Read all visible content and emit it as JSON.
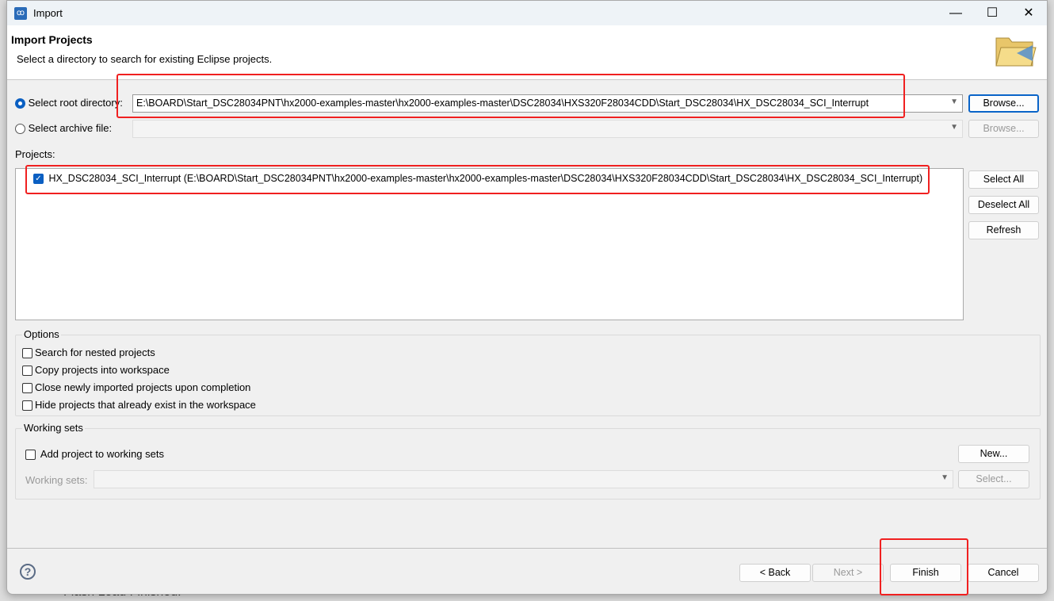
{
  "background_text": "Flash Load Finished.",
  "window": {
    "title": "Import"
  },
  "header": {
    "title": "Import Projects",
    "subtitle": "Select a directory to search for existing Eclipse projects."
  },
  "source": {
    "root_label": "Select root directory:",
    "root_value": "E:\\BOARD\\Start_DSC28034PNT\\hx2000-examples-master\\hx2000-examples-master\\DSC28034\\HXS320F28034CDD\\Start_DSC28034\\HX_DSC28034_SCI_Interrupt",
    "archive_label": "Select archive file:",
    "archive_value": "",
    "browse": "Browse...",
    "browse2": "Browse..."
  },
  "projects": {
    "label": "Projects:",
    "items": [
      {
        "label": "HX_DSC28034_SCI_Interrupt (E:\\BOARD\\Start_DSC28034PNT\\hx2000-examples-master\\hx2000-examples-master\\DSC28034\\HXS320F28034CDD\\Start_DSC28034\\HX_DSC28034_SCI_Interrupt)",
        "checked": true
      }
    ],
    "select_all": "Select All",
    "deselect_all": "Deselect All",
    "refresh": "Refresh"
  },
  "options": {
    "title": "Options",
    "items": [
      {
        "label": "Search for nested projects",
        "checked": false
      },
      {
        "label": "Copy projects into workspace",
        "checked": false
      },
      {
        "label": "Close newly imported projects upon completion",
        "checked": false
      },
      {
        "label": "Hide projects that already exist in the workspace",
        "checked": false
      }
    ]
  },
  "working_sets": {
    "title": "Working sets",
    "add_label": "Add project to working sets",
    "add_checked": false,
    "new": "New...",
    "sets_label": "Working sets:",
    "sets_value": "",
    "select": "Select..."
  },
  "footer": {
    "back": "< Back",
    "next": "Next >",
    "finish": "Finish",
    "cancel": "Cancel"
  },
  "colors": {
    "accent": "#0a5fc2",
    "highlight": "#f02020"
  }
}
